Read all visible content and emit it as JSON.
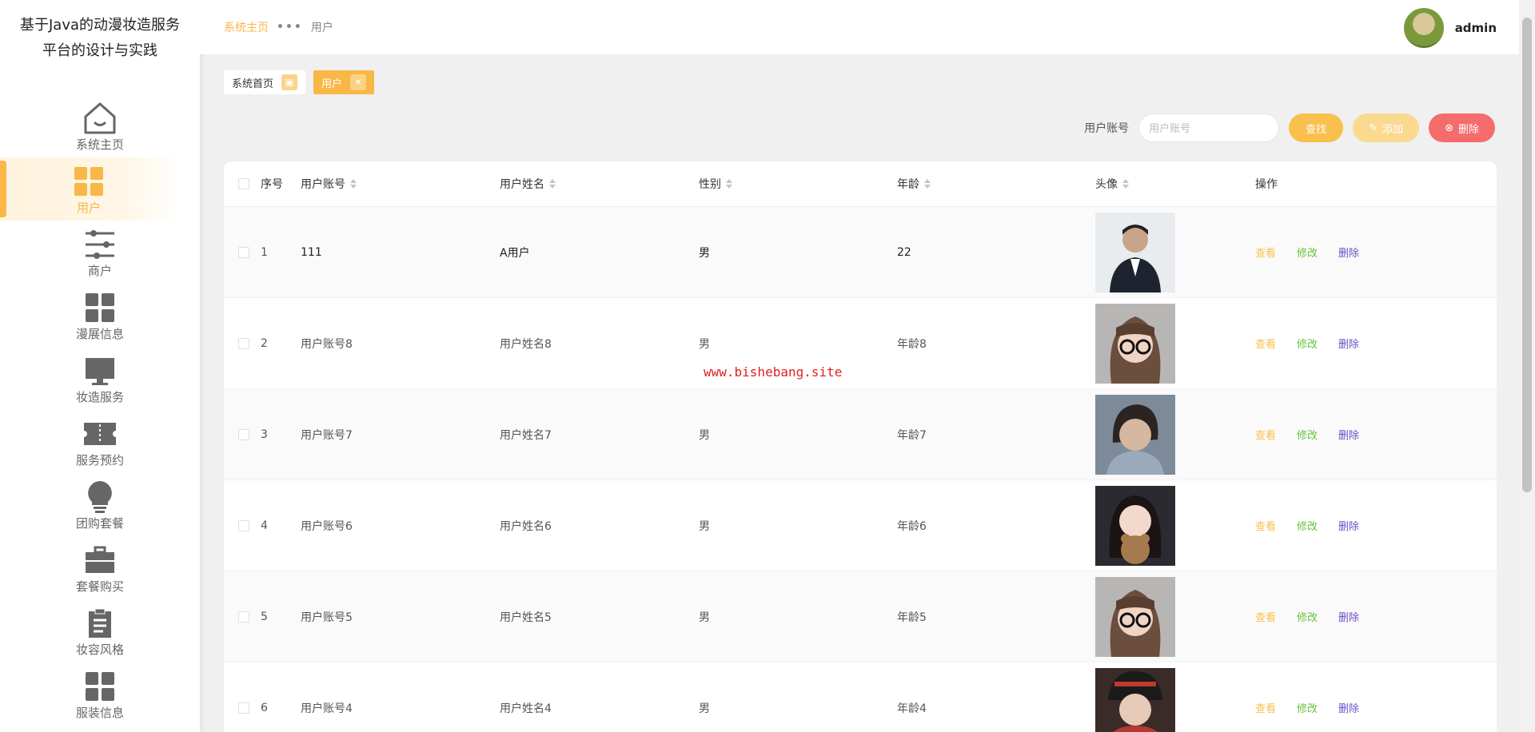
{
  "app": {
    "title_line1": "基于Java的动漫妆造服务",
    "title_line2": "平台的设计与实践"
  },
  "sidebar": {
    "items": [
      {
        "label": "系统主页",
        "icon": "home-icon"
      },
      {
        "label": "用户",
        "icon": "grid-icon",
        "active": true
      },
      {
        "label": "商户",
        "icon": "sliders-icon"
      },
      {
        "label": "漫展信息",
        "icon": "grid-icon"
      },
      {
        "label": "妆造服务",
        "icon": "monitor-icon"
      },
      {
        "label": "服务预约",
        "icon": "ticket-icon"
      },
      {
        "label": "团购套餐",
        "icon": "bulb-icon"
      },
      {
        "label": "套餐购买",
        "icon": "briefcase-icon"
      },
      {
        "label": "妆容风格",
        "icon": "clipboard-icon"
      },
      {
        "label": "服装信息",
        "icon": "grid-icon"
      }
    ]
  },
  "header": {
    "breadcrumb_home": "系统主页",
    "breadcrumb_sep": "•••",
    "breadcrumb_current": "用户",
    "username": "admin"
  },
  "tabs": [
    {
      "label": "系统首页"
    },
    {
      "label": "用户",
      "active": true
    }
  ],
  "search": {
    "label": "用户账号",
    "placeholder": "用户账号",
    "search_btn": "查找",
    "add_btn": "添加",
    "delete_btn": "删除"
  },
  "table": {
    "headers": {
      "index": "序号",
      "account": "用户账号",
      "name": "用户姓名",
      "gender": "性别",
      "age": "年龄",
      "avatar": "头像",
      "ops": "操作"
    },
    "op_labels": {
      "view": "查看",
      "edit": "修改",
      "delete": "删除"
    },
    "rows": [
      {
        "index": "1",
        "account": "111",
        "name": "A用户",
        "gender": "男",
        "age": "22"
      },
      {
        "index": "2",
        "account": "用户账号8",
        "name": "用户姓名8",
        "gender": "男",
        "age": "年龄8"
      },
      {
        "index": "3",
        "account": "用户账号7",
        "name": "用户姓名7",
        "gender": "男",
        "age": "年龄7"
      },
      {
        "index": "4",
        "account": "用户账号6",
        "name": "用户姓名6",
        "gender": "男",
        "age": "年龄6"
      },
      {
        "index": "5",
        "account": "用户账号5",
        "name": "用户姓名5",
        "gender": "男",
        "age": "年龄5"
      },
      {
        "index": "6",
        "account": "用户账号4",
        "name": "用户姓名4",
        "gender": "男",
        "age": "年龄4"
      }
    ]
  },
  "watermark": "www.bishebang.site",
  "colors": {
    "accent": "#f9b747",
    "danger": "#f56c6c",
    "edit": "#67c23a",
    "delete_link": "#6b4ec9"
  }
}
